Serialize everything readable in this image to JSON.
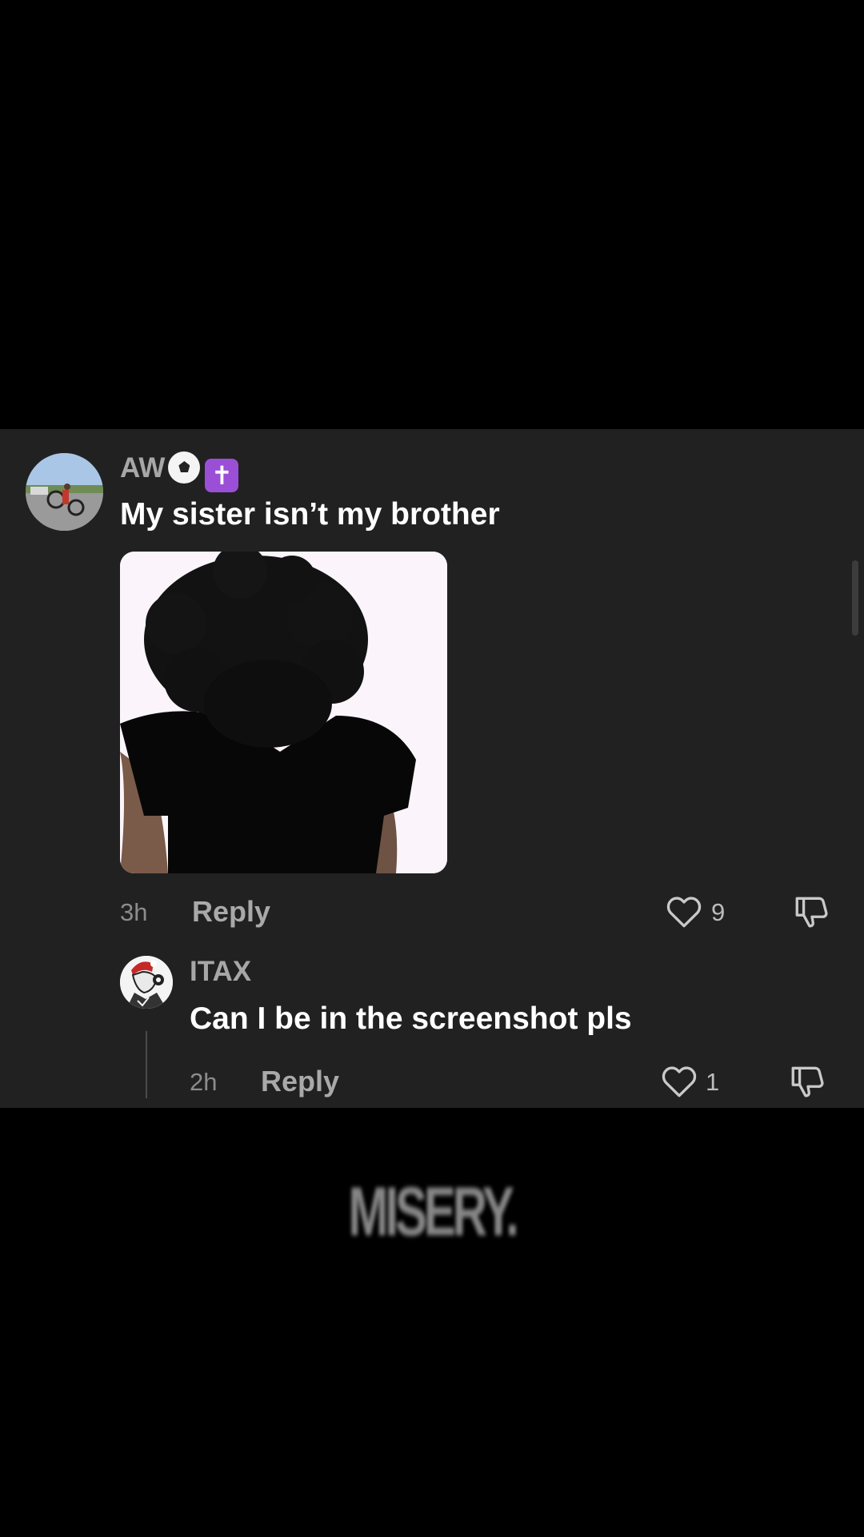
{
  "comments": [
    {
      "username": "AW",
      "username_badges": [
        "soccer-ball",
        "latin-cross"
      ],
      "text": "My sister isn’t my brother",
      "has_image": true,
      "time": "3h",
      "reply_label": "Reply",
      "likes": "9"
    },
    {
      "username": "ITAX",
      "text": "Can I be in the screenshot pls",
      "time": "2h",
      "reply_label": "Reply",
      "likes": "1"
    }
  ],
  "watermark": "MISERY.",
  "icons": {
    "like": "heart-outline-icon",
    "dislike": "thumbs-down-icon"
  },
  "colors": {
    "panel_bg": "#212122",
    "page_bg": "#000000",
    "username": "#a7a7a8",
    "meta": "#8c8c8d",
    "cross_badge": "#9b4fd6"
  }
}
